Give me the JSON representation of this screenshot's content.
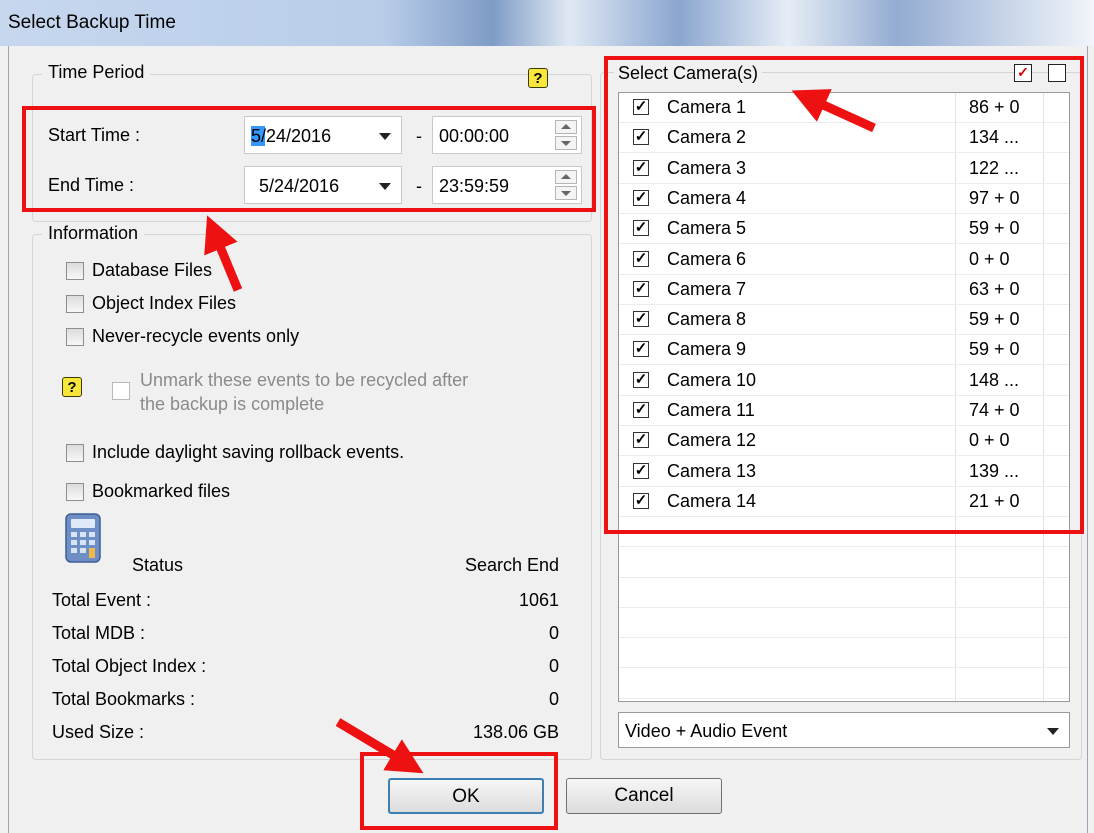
{
  "window": {
    "title": "Select Backup Time"
  },
  "time_period": {
    "legend": "Time Period",
    "help": "?",
    "start_label": "Start Time :",
    "start_date": "5/24/2016",
    "start_time": "00:00:00",
    "end_label": "End Time :",
    "end_date": "5/24/2016",
    "end_time": "23:59:59",
    "dash": "-"
  },
  "information": {
    "legend": "Information",
    "options": [
      {
        "label": "Database Files",
        "checked": false
      },
      {
        "label": "Object Index Files",
        "checked": false
      },
      {
        "label": "Never-recycle events only",
        "checked": false
      }
    ],
    "unmark_line1": "Unmark these events to be recycled after",
    "unmark_line2": "the backup is complete",
    "help": "?",
    "daylight": "Include daylight saving rollback events.",
    "bookmarked": "Bookmarked files"
  },
  "status": {
    "header_label": "Status",
    "header_value": "Search End",
    "rows": [
      {
        "label": "Total Event :",
        "value": "1061"
      },
      {
        "label": "Total MDB :",
        "value": "0"
      },
      {
        "label": "Total Object Index :",
        "value": "0"
      },
      {
        "label": "Total Bookmarks :",
        "value": "0"
      },
      {
        "label": "Used Size :",
        "value": "138.06 GB"
      }
    ]
  },
  "cameras": {
    "legend": "Select Camera(s)",
    "items": [
      {
        "name": "Camera 1",
        "count": "86 + 0",
        "checked": true
      },
      {
        "name": "Camera 2",
        "count": "134 ...",
        "checked": true
      },
      {
        "name": "Camera 3",
        "count": "122 ...",
        "checked": true
      },
      {
        "name": "Camera 4",
        "count": "97 + 0",
        "checked": true
      },
      {
        "name": "Camera 5",
        "count": "59 + 0",
        "checked": true
      },
      {
        "name": "Camera 6",
        "count": "0 + 0",
        "checked": true
      },
      {
        "name": "Camera 7",
        "count": "63 + 0",
        "checked": true
      },
      {
        "name": "Camera 8",
        "count": "59 + 0",
        "checked": true
      },
      {
        "name": "Camera 9",
        "count": "59 + 0",
        "checked": true
      },
      {
        "name": "Camera 10",
        "count": "148 ...",
        "checked": true
      },
      {
        "name": "Camera 11",
        "count": "74 + 0",
        "checked": true
      },
      {
        "name": "Camera 12",
        "count": "0 + 0",
        "checked": true
      },
      {
        "name": "Camera 13",
        "count": "139 ...",
        "checked": true
      },
      {
        "name": "Camera 14",
        "count": "21 + 0",
        "checked": true
      }
    ],
    "event_type": "Video + Audio Event"
  },
  "buttons": {
    "ok": "OK",
    "cancel": "Cancel"
  },
  "colors": {
    "annotation": "#ee1111",
    "selection": "#3399ff"
  }
}
